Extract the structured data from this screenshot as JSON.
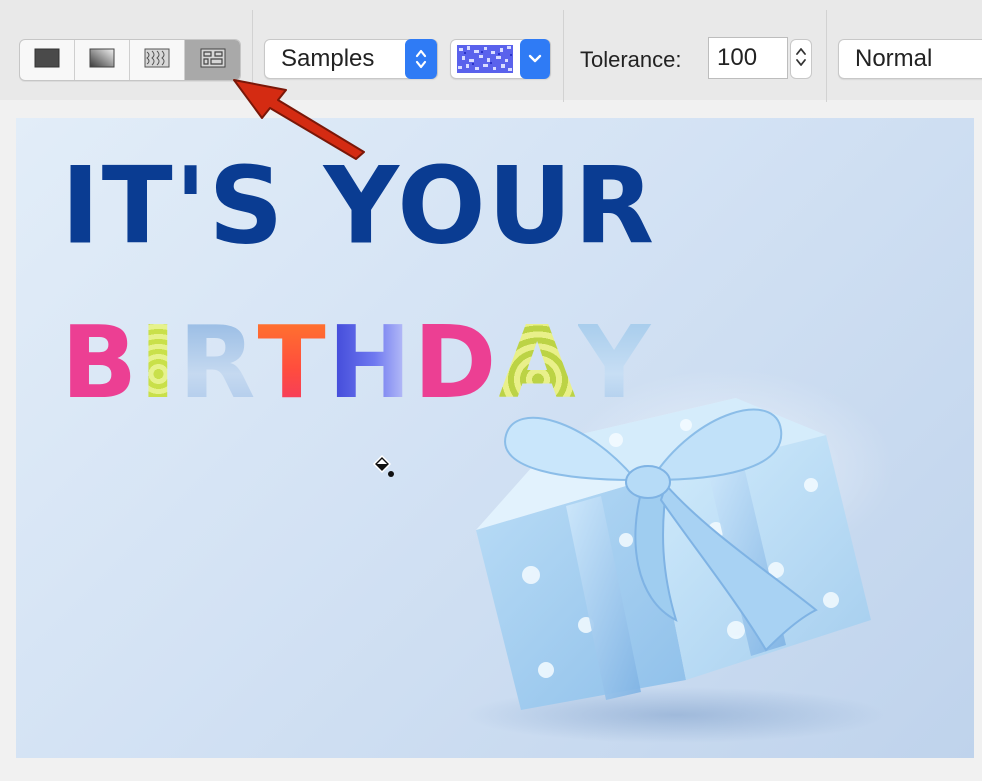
{
  "toolbar": {
    "fill_modes": [
      {
        "id": "solid",
        "icon": "solid-fill-icon",
        "active": false
      },
      {
        "id": "gradient",
        "icon": "gradient-fill-icon",
        "active": false
      },
      {
        "id": "texture",
        "icon": "texture-fill-icon",
        "active": false
      },
      {
        "id": "pattern",
        "icon": "pattern-fill-icon",
        "active": true
      }
    ],
    "source_select": {
      "value": "Samples"
    },
    "pattern_swatch": {
      "icon": "pattern-swatch-icon",
      "color": "#4b54e8"
    },
    "tolerance": {
      "label": "Tolerance:",
      "value": "100"
    },
    "blend_mode": {
      "value": "Normal"
    }
  },
  "canvas": {
    "headline": "IT'S YOUR",
    "birthday_letters": [
      "B",
      "I",
      "R",
      "T",
      "H",
      "D",
      "A",
      "Y"
    ]
  },
  "annotation": {
    "arrow_color": "#d42b12"
  },
  "colors": {
    "headline": "#0a3c92",
    "pink": "#ec3f93",
    "accent_blue": "#2f7bf5"
  }
}
